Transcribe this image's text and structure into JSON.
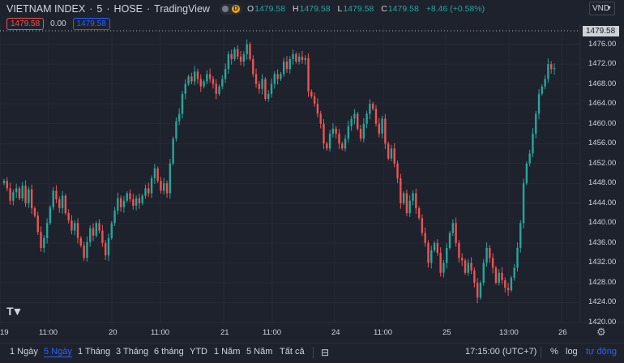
{
  "header": {
    "symbol": "VIETNAM INDEX",
    "interval": "5",
    "exchange": "HOSE",
    "provider": "TradingView",
    "status_letter": "D",
    "ohlc": {
      "o_key": "O",
      "o": "1479.58",
      "h_key": "H",
      "h": "1479.58",
      "l_key": "L",
      "l": "1479.58",
      "c_key": "C",
      "c": "1479.58",
      "change": "+8.46 (+0.58%)"
    },
    "sell_price": "1479.58",
    "spread": "0.00",
    "buy_price": "1479.58",
    "currency": "VND"
  },
  "price_axis": {
    "current_price": "1479.58",
    "ticks": [
      "1476.00",
      "1472.00",
      "1468.00",
      "1464.00",
      "1460.00",
      "1456.00",
      "1452.00",
      "1448.00",
      "1444.00",
      "1440.00",
      "1436.00",
      "1432.00",
      "1428.00",
      "1424.00",
      "1420.00"
    ]
  },
  "time_axis": {
    "labels": [
      "19",
      "11:00",
      "20",
      "11:00",
      "21",
      "11:00",
      "24",
      "11:00",
      "25",
      "13:00",
      "26"
    ]
  },
  "bottom_bar": {
    "ranges": [
      "1 Ngày",
      "5 Ngày",
      "1 Tháng",
      "3 Tháng",
      "6 tháng",
      "YTD",
      "1 Năm",
      "5 Năm",
      "Tất cả"
    ],
    "active_range": "5 Ngày",
    "time": "17:15:00 (UTC+7)",
    "percent": "%",
    "log": "log",
    "auto": "tự động"
  },
  "icons": {
    "calendar": "calendar-range-icon",
    "settings": "gear-icon",
    "logo": "tradingview-logo-icon"
  },
  "colors": {
    "up": "#26a69a",
    "down": "#ef5350",
    "accent": "#2962ff",
    "background": "#1e222d"
  },
  "chart_data": {
    "type": "candlestick",
    "ylim": [
      1420,
      1480
    ],
    "x_labels": [
      "19",
      "11:00",
      "20",
      "11:00",
      "21",
      "11:00",
      "24",
      "11:00",
      "25",
      "13:00",
      "26"
    ],
    "close": [
      1448.5,
      1447.0,
      1444.5,
      1446.2,
      1447.0,
      1445.0,
      1447.5,
      1444.0,
      1446.8,
      1443.0,
      1441.5,
      1438.2,
      1435.0,
      1437.0,
      1440.0,
      1443.2,
      1446.5,
      1444.8,
      1443.0,
      1445.5,
      1442.0,
      1440.5,
      1438.5,
      1440.0,
      1437.0,
      1435.5,
      1433.0,
      1436.2,
      1439.0,
      1437.5,
      1440.0,
      1438.5,
      1436.0,
      1433.5,
      1437.0,
      1440.0,
      1442.5,
      1445.0,
      1443.2,
      1444.5,
      1446.0,
      1444.8,
      1443.5,
      1445.0,
      1444.0,
      1445.5,
      1447.0,
      1446.0,
      1449.0,
      1451.0,
      1448.5,
      1446.5,
      1448.0,
      1446.0,
      1452.0,
      1457.0,
      1460.5,
      1462.0,
      1466.0,
      1468.0,
      1469.5,
      1468.5,
      1470.5,
      1469.0,
      1467.5,
      1468.5,
      1470.0,
      1469.0,
      1468.0,
      1466.0,
      1467.5,
      1469.0,
      1471.0,
      1474.0,
      1473.0,
      1475.0,
      1473.5,
      1472.5,
      1474.0,
      1476.0,
      1473.0,
      1470.0,
      1468.0,
      1467.0,
      1469.0,
      1465.0,
      1466.0,
      1468.0,
      1470.0,
      1469.0,
      1470.0,
      1472.5,
      1471.0,
      1473.0,
      1474.0,
      1472.5,
      1473.5,
      1472.8,
      1473.2,
      1466.5,
      1465.5,
      1464.0,
      1462.0,
      1460.0,
      1456.0,
      1455.0,
      1458.0,
      1459.0,
      1458.0,
      1456.0,
      1455.0,
      1457.0,
      1459.5,
      1461.0,
      1462.0,
      1459.0,
      1457.0,
      1460.0,
      1462.0,
      1464.0,
      1463.0,
      1460.0,
      1458.0,
      1461.0,
      1456.0,
      1453.0,
      1455.0,
      1452.0,
      1449.0,
      1444.0,
      1446.0,
      1442.0,
      1444.5,
      1446.0,
      1443.0,
      1441.0,
      1438.0,
      1436.0,
      1432.0,
      1434.5,
      1436.0,
      1434.0,
      1430.0,
      1432.0,
      1435.0,
      1438.0,
      1440.0,
      1436.0,
      1433.0,
      1432.5,
      1430.0,
      1432.0,
      1430.5,
      1428.0,
      1425.0,
      1428.0,
      1432.0,
      1435.0,
      1433.0,
      1431.0,
      1428.0,
      1430.0,
      1428.5,
      1427.0,
      1426.5,
      1429.0,
      1431.0,
      1435.0,
      1440.0,
      1448.0,
      1452.0,
      1454.0,
      1458.0,
      1462.0,
      1466.0,
      1467.5,
      1469.0,
      1472.0,
      1471.0,
      1471.2
    ]
  }
}
